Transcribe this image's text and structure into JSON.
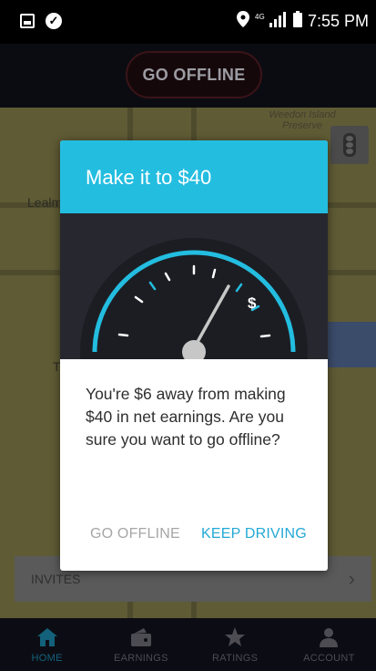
{
  "status_bar": {
    "time": "7:55 PM",
    "icons": [
      "image-icon",
      "check-circle-icon",
      "location-icon",
      "4g-signal-icon",
      "battery-icon"
    ]
  },
  "top_bar": {
    "go_offline_label": "GO OFFLINE"
  },
  "map": {
    "labels": {
      "place_1": "Weedon Island",
      "place_2": "Preserve",
      "place_3": "Lealm",
      "place_4": "T"
    },
    "traffic_button_icon": "traffic-light-icon"
  },
  "modal": {
    "title": "Make it to $40",
    "gauge_symbol": "$",
    "message": "You're $6 away from making $40 in net earnings. Are you sure you want to go offline?",
    "secondary_action": "GO OFFLINE",
    "primary_action": "KEEP DRIVING",
    "colors": {
      "header": "#23bde0",
      "gauge_background": "#27282f",
      "gauge_accent": "#23bde0",
      "primary_action": "#23a9d6"
    }
  },
  "invites": {
    "label": "INVITES"
  },
  "bottom_nav": {
    "items": [
      {
        "label": "HOME",
        "icon": "home-icon",
        "active": true
      },
      {
        "label": "EARNINGS",
        "icon": "wallet-icon",
        "active": false
      },
      {
        "label": "RATINGS",
        "icon": "star-icon",
        "active": false
      },
      {
        "label": "ACCOUNT",
        "icon": "person-icon",
        "active": false
      }
    ]
  }
}
